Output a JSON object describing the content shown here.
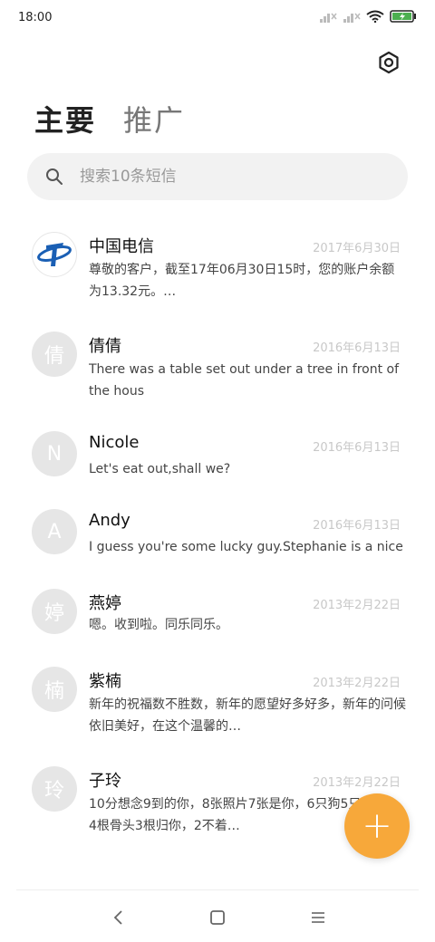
{
  "status": {
    "time": "18:00",
    "battery_color": "#4caf50"
  },
  "tabs": [
    {
      "label": "主要",
      "active": true
    },
    {
      "label": "推广",
      "active": false
    }
  ],
  "search": {
    "placeholder": "搜索10条短信"
  },
  "messages": [
    {
      "avatar": "ct-logo",
      "name": "中国电信",
      "date": "2017年6月30日",
      "preview": "尊敬的客户，截至17年06月30日15时，您的账户余额为13.32元。…"
    },
    {
      "avatar": "倩",
      "name": "倩倩",
      "date": "2016年6月13日",
      "preview": "There was a table set out under a tree in front of the hous"
    },
    {
      "avatar": "N",
      "name": "Nicole",
      "date": "2016年6月13日",
      "preview": "Let's eat out,shall we?"
    },
    {
      "avatar": "A",
      "name": "Andy",
      "date": "2016年6月13日",
      "preview": "I guess you're some lucky guy.Stephanie is a nice girl."
    },
    {
      "avatar": "婷",
      "name": "燕婷",
      "date": "2013年2月22日",
      "preview": "嗯。收到啦。同乐同乐。"
    },
    {
      "avatar": "楠",
      "name": "紫楠",
      "date": "2013年2月22日",
      "preview": "新年的祝福数不胜数，新年的愿望好多好多，新年的问候依旧美好，在这个温馨的…"
    },
    {
      "avatar": "玲",
      "name": "子玲",
      "date": "2013年2月22日",
      "preview": "10分想念9到的你，8张照片7张是你，6只狗5只像你，4根骨头3根归你，2不着…"
    }
  ],
  "fab": {
    "label": "+",
    "color": "#f7a83a"
  },
  "nav": {
    "back": "back-icon",
    "home": "home-icon",
    "menu": "menu-icon"
  }
}
